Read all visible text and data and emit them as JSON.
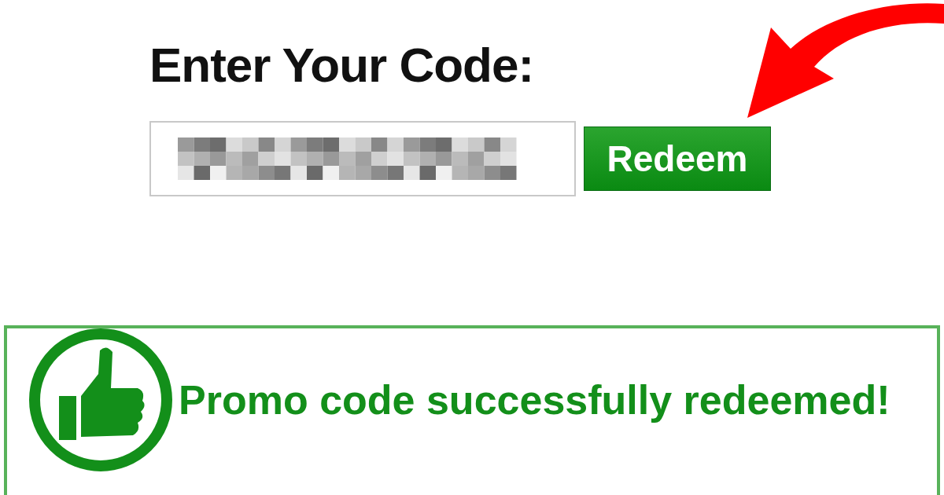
{
  "heading": "Enter Your Code:",
  "redeem_button": {
    "label": "Redeem"
  },
  "message": {
    "kind": "success",
    "text": "Promo code successfully redeemed!"
  }
}
